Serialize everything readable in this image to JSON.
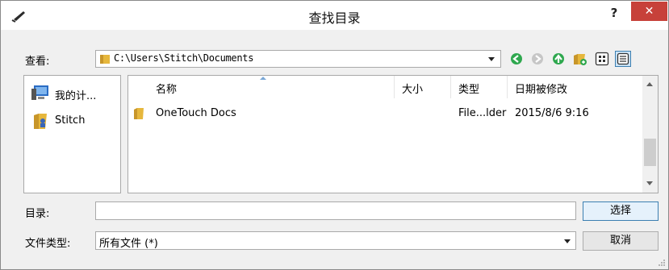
{
  "window": {
    "title": "查找目录",
    "help_label": "?",
    "close_label": "✕"
  },
  "look_in": {
    "label": "查看:",
    "path": "C:\\Users\\Stitch\\Documents"
  },
  "places": [
    {
      "label": "我的计...",
      "icon": "computer-icon"
    },
    {
      "label": "Stitch",
      "icon": "user-folder-icon"
    }
  ],
  "file_list": {
    "columns": [
      "名称",
      "大小",
      "类型",
      "日期被修改"
    ],
    "rows": [
      {
        "name": "OneTouch Docs",
        "size": "",
        "type": "File...lder",
        "modified": "2015/8/6 9:16"
      }
    ]
  },
  "directory": {
    "label": "目录:",
    "value": ""
  },
  "file_type": {
    "label": "文件类型:",
    "value": "所有文件 (*)"
  },
  "buttons": {
    "select": "选择",
    "cancel": "取消"
  },
  "colors": {
    "close": "#c7413a",
    "nav_green": "#2fa84f",
    "folder": "#e6b73c"
  }
}
